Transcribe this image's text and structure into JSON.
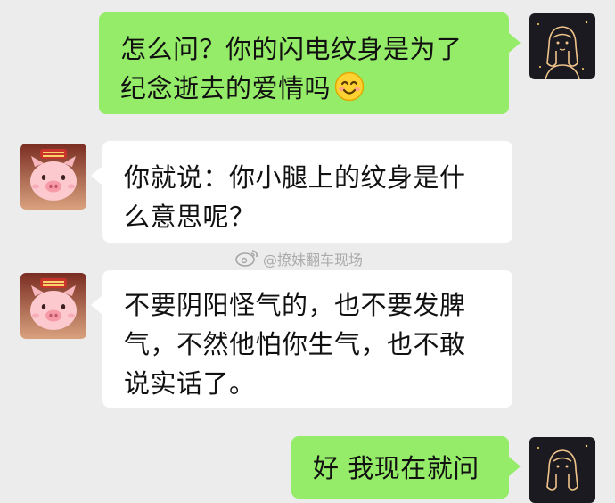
{
  "messages": [
    {
      "side": "right",
      "text": "怎么问？你的闪电纹身是为了纪念逝去的爱情吗",
      "emoji_icon": "smiling-face-emoji"
    },
    {
      "side": "left",
      "text": "你就说：你小腿上的纹身是什么意思呢？"
    },
    {
      "side": "left",
      "text": "不要阴阳怪气的，也不要发脾气，不然他怕你生气，也不敢说实话了。"
    },
    {
      "side": "right",
      "text": "好 我现在就问"
    }
  ],
  "avatars": {
    "self_icon": "line-drawing-girl-avatar",
    "other_icon": "pig-character-avatar"
  },
  "watermark": {
    "icon": "weibo-logo-icon",
    "text": "@撩妹翻车现场"
  },
  "colors": {
    "background": "#ececec",
    "sent_bubble": "#95ec69",
    "received_bubble": "#ffffff",
    "text": "#111111"
  }
}
